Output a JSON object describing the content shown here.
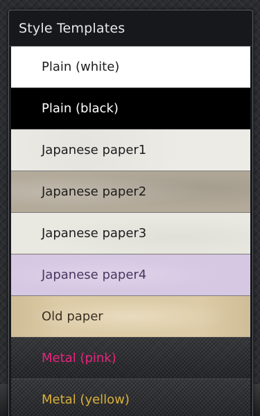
{
  "dialog": {
    "title": "Style Templates"
  },
  "templates": [
    {
      "label": "Plain (white)"
    },
    {
      "label": "Plain (black)"
    },
    {
      "label": "Japanese paper1"
    },
    {
      "label": "Japanese paper2"
    },
    {
      "label": "Japanese paper3"
    },
    {
      "label": "Japanese paper4"
    },
    {
      "label": "Old paper"
    },
    {
      "label": "Metal (pink)"
    },
    {
      "label": "Metal (yellow)"
    }
  ],
  "colors": {
    "dialog_background": "#16181c",
    "title_text": "#e8e8e8",
    "metal_pink_text": "#e8247e",
    "metal_yellow_text": "#d9b13a"
  }
}
